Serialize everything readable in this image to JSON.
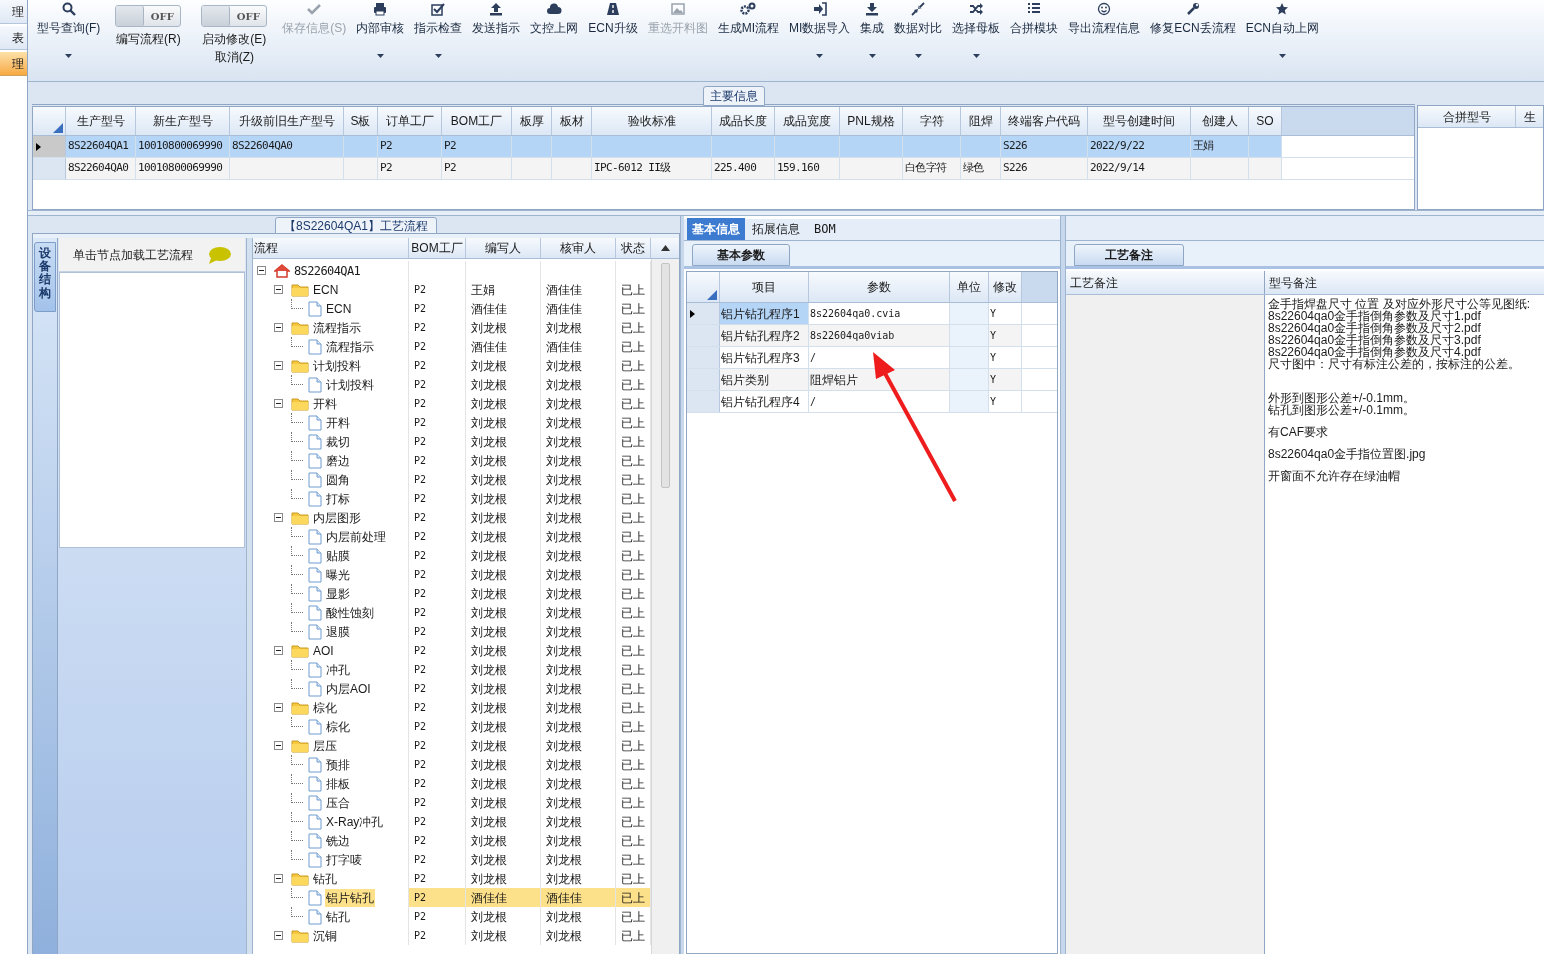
{
  "left_strip": [
    {
      "label": "理",
      "selected": false
    },
    {
      "label": "表",
      "selected": false
    },
    {
      "label": "理",
      "selected": true
    }
  ],
  "toolbar": [
    {
      "kind": "button",
      "label": "型号查询(F)",
      "disabled": false,
      "dropdown": true
    },
    {
      "kind": "toggle",
      "switch_text": "OFF",
      "on": false,
      "label": "编写流程(R)"
    },
    {
      "kind": "toggle",
      "switch_text": "OFF",
      "on": false,
      "label": "启动修改(E)",
      "label2": "取消(Z)"
    },
    {
      "kind": "button",
      "label": "保存信息(S)",
      "disabled": true,
      "dropdown": false
    },
    {
      "kind": "button",
      "label": "内部审核",
      "disabled": false,
      "dropdown": true
    },
    {
      "kind": "button",
      "label": "指示检查",
      "disabled": false,
      "dropdown": true
    },
    {
      "kind": "button",
      "label": "发送指示",
      "disabled": false,
      "dropdown": false
    },
    {
      "kind": "button",
      "label": "文控上网",
      "disabled": false,
      "dropdown": false
    },
    {
      "kind": "button",
      "label": "ECN升级",
      "disabled": false,
      "dropdown": false
    },
    {
      "kind": "button",
      "label": "重选开料图",
      "disabled": true,
      "dropdown": false
    },
    {
      "kind": "button",
      "label": "生成MI流程",
      "disabled": false,
      "dropdown": false
    },
    {
      "kind": "button",
      "label": "MI数据导入",
      "disabled": false,
      "dropdown": true
    },
    {
      "kind": "button",
      "label": "集成",
      "disabled": false,
      "dropdown": true
    },
    {
      "kind": "button",
      "label": "数据对比",
      "disabled": false,
      "dropdown": true
    },
    {
      "kind": "button",
      "label": "选择母板",
      "disabled": false,
      "dropdown": true
    },
    {
      "kind": "button",
      "label": "合拼模块",
      "disabled": false,
      "dropdown": false
    },
    {
      "kind": "button",
      "label": "导出流程信息",
      "disabled": false,
      "dropdown": false
    },
    {
      "kind": "button",
      "label": "修复ECN丢流程",
      "disabled": false,
      "dropdown": false
    },
    {
      "kind": "button",
      "label": "ECN自动上网",
      "disabled": false,
      "dropdown": true
    }
  ],
  "main_info": {
    "title": "主要信息",
    "columns": [
      "生产型号",
      "新生产型号",
      "升级前旧生产型号",
      "S板",
      "订单工厂",
      "BOM工厂",
      "板厚",
      "板材",
      "验收标准",
      "成品长度",
      "成品宽度",
      "PNL规格",
      "字符",
      "阻焊",
      "终端客户代码",
      "型号创建时间",
      "创建人",
      "SO"
    ],
    "rows": [
      {
        "selected": true,
        "cells": [
          "8S22604QA1",
          "10010800069990",
          "8S22604QA0",
          null,
          "P2",
          "P2",
          null,
          null,
          null,
          null,
          null,
          null,
          null,
          null,
          "S226",
          "2022/9/22",
          "王娟",
          null
        ]
      },
      {
        "selected": false,
        "cells": [
          "8S22604QA0",
          "10010800069990",
          null,
          null,
          "P2",
          "P2",
          null,
          null,
          "IPC-6012 II级",
          "225.400",
          "159.160",
          null,
          "白色字符",
          "绿色",
          "S226",
          "2022/9/14",
          null,
          null
        ]
      }
    ]
  },
  "merge_panel": {
    "columns": [
      "合拼型号",
      "生"
    ]
  },
  "process": {
    "title": "【8S22604QA1】工艺流程",
    "side_tab": "设备结构",
    "hint": "单击节点加载工艺流程",
    "columns": [
      "流程",
      "BOM工厂",
      "编写人",
      "核审人",
      "状态"
    ],
    "tree": [
      {
        "kind": "root",
        "label": "8S22604QA1",
        "selected": false,
        "expanded": true,
        "children": [
          {
            "kind": "folder",
            "label": "ECN",
            "bom": "P2",
            "writer": "王娟",
            "reviewer": "酒佳佳",
            "status": "已上",
            "selected": false,
            "expanded": true,
            "children": [
              {
                "kind": "leaf",
                "label": "ECN",
                "bom": "P2",
                "writer": "酒佳佳",
                "reviewer": "酒佳佳",
                "status": "已上",
                "selected": false
              }
            ]
          },
          {
            "kind": "folder",
            "label": "流程指示",
            "bom": "P2",
            "writer": "刘龙根",
            "reviewer": "刘龙根",
            "status": "已上",
            "selected": false,
            "expanded": true,
            "children": [
              {
                "kind": "leaf",
                "label": "流程指示",
                "bom": "P2",
                "writer": "酒佳佳",
                "reviewer": "酒佳佳",
                "status": "已上",
                "selected": false
              }
            ]
          },
          {
            "kind": "folder",
            "label": "计划投料",
            "bom": "P2",
            "writer": "刘龙根",
            "reviewer": "刘龙根",
            "status": "已上",
            "selected": false,
            "expanded": true,
            "children": [
              {
                "kind": "leaf",
                "label": "计划投料",
                "bom": "P2",
                "writer": "刘龙根",
                "reviewer": "刘龙根",
                "status": "已上",
                "selected": false
              }
            ]
          },
          {
            "kind": "folder",
            "label": "开料",
            "bom": "P2",
            "writer": "刘龙根",
            "reviewer": "刘龙根",
            "status": "已上",
            "selected": false,
            "expanded": true,
            "children": [
              {
                "kind": "leaf",
                "label": "开料",
                "bom": "P2",
                "writer": "刘龙根",
                "reviewer": "刘龙根",
                "status": "已上",
                "selected": false
              },
              {
                "kind": "leaf",
                "label": "裁切",
                "bom": "P2",
                "writer": "刘龙根",
                "reviewer": "刘龙根",
                "status": "已上",
                "selected": false
              },
              {
                "kind": "leaf",
                "label": "磨边",
                "bom": "P2",
                "writer": "刘龙根",
                "reviewer": "刘龙根",
                "status": "已上",
                "selected": false
              },
              {
                "kind": "leaf",
                "label": "圆角",
                "bom": "P2",
                "writer": "刘龙根",
                "reviewer": "刘龙根",
                "status": "已上",
                "selected": false
              },
              {
                "kind": "leaf",
                "label": "打标",
                "bom": "P2",
                "writer": "刘龙根",
                "reviewer": "刘龙根",
                "status": "已上",
                "selected": false
              }
            ]
          },
          {
            "kind": "folder",
            "label": "内层图形",
            "bom": "P2",
            "writer": "刘龙根",
            "reviewer": "刘龙根",
            "status": "已上",
            "selected": false,
            "expanded": true,
            "children": [
              {
                "kind": "leaf",
                "label": "内层前处理",
                "bom": "P2",
                "writer": "刘龙根",
                "reviewer": "刘龙根",
                "status": "已上",
                "selected": false
              },
              {
                "kind": "leaf",
                "label": "贴膜",
                "bom": "P2",
                "writer": "刘龙根",
                "reviewer": "刘龙根",
                "status": "已上",
                "selected": false
              },
              {
                "kind": "leaf",
                "label": "曝光",
                "bom": "P2",
                "writer": "刘龙根",
                "reviewer": "刘龙根",
                "status": "已上",
                "selected": false
              },
              {
                "kind": "leaf",
                "label": "显影",
                "bom": "P2",
                "writer": "刘龙根",
                "reviewer": "刘龙根",
                "status": "已上",
                "selected": false
              },
              {
                "kind": "leaf",
                "label": "酸性蚀刻",
                "bom": "P2",
                "writer": "刘龙根",
                "reviewer": "刘龙根",
                "status": "已上",
                "selected": false
              },
              {
                "kind": "leaf",
                "label": "退膜",
                "bom": "P2",
                "writer": "刘龙根",
                "reviewer": "刘龙根",
                "status": "已上",
                "selected": false
              }
            ]
          },
          {
            "kind": "folder",
            "label": "AOI",
            "bom": "P2",
            "writer": "刘龙根",
            "reviewer": "刘龙根",
            "status": "已上",
            "selected": false,
            "expanded": true,
            "children": [
              {
                "kind": "leaf",
                "label": "冲孔",
                "bom": "P2",
                "writer": "刘龙根",
                "reviewer": "刘龙根",
                "status": "已上",
                "selected": false
              },
              {
                "kind": "leaf",
                "label": "内层AOI",
                "bom": "P2",
                "writer": "刘龙根",
                "reviewer": "刘龙根",
                "status": "已上",
                "selected": false
              }
            ]
          },
          {
            "kind": "folder",
            "label": "棕化",
            "bom": "P2",
            "writer": "刘龙根",
            "reviewer": "刘龙根",
            "status": "已上",
            "selected": false,
            "expanded": true,
            "children": [
              {
                "kind": "leaf",
                "label": "棕化",
                "bom": "P2",
                "writer": "刘龙根",
                "reviewer": "刘龙根",
                "status": "已上",
                "selected": false
              }
            ]
          },
          {
            "kind": "folder",
            "label": "层压",
            "bom": "P2",
            "writer": "刘龙根",
            "reviewer": "刘龙根",
            "status": "已上",
            "selected": false,
            "expanded": true,
            "children": [
              {
                "kind": "leaf",
                "label": "预排",
                "bom": "P2",
                "writer": "刘龙根",
                "reviewer": "刘龙根",
                "status": "已上",
                "selected": false
              },
              {
                "kind": "leaf",
                "label": "排板",
                "bom": "P2",
                "writer": "刘龙根",
                "reviewer": "刘龙根",
                "status": "已上",
                "selected": false
              },
              {
                "kind": "leaf",
                "label": "压合",
                "bom": "P2",
                "writer": "刘龙根",
                "reviewer": "刘龙根",
                "status": "已上",
                "selected": false
              },
              {
                "kind": "leaf",
                "label": "X-Ray冲孔",
                "bom": "P2",
                "writer": "刘龙根",
                "reviewer": "刘龙根",
                "status": "已上",
                "selected": false
              },
              {
                "kind": "leaf",
                "label": "铣边",
                "bom": "P2",
                "writer": "刘龙根",
                "reviewer": "刘龙根",
                "status": "已上",
                "selected": false
              },
              {
                "kind": "leaf",
                "label": "打字唛",
                "bom": "P2",
                "writer": "刘龙根",
                "reviewer": "刘龙根",
                "status": "已上",
                "selected": false
              }
            ]
          },
          {
            "kind": "folder",
            "label": "钻孔",
            "bom": "P2",
            "writer": "刘龙根",
            "reviewer": "刘龙根",
            "status": "已上",
            "selected": false,
            "expanded": true,
            "children": [
              {
                "kind": "leaf",
                "label": "铝片钻孔",
                "bom": "P2",
                "writer": "酒佳佳",
                "reviewer": "酒佳佳",
                "status": "已上",
                "selected": true
              },
              {
                "kind": "leaf",
                "label": "钻孔",
                "bom": "P2",
                "writer": "刘龙根",
                "reviewer": "刘龙根",
                "status": "已上",
                "selected": false
              }
            ]
          },
          {
            "kind": "folder",
            "label": "沉铜",
            "bom": "P2",
            "writer": "刘龙根",
            "reviewer": "刘龙根",
            "status": "已上",
            "selected": false,
            "expanded": true
          }
        ]
      }
    ]
  },
  "detail": {
    "tabs": [
      {
        "label": "基本信息",
        "selected": true
      },
      {
        "label": "拓展信息",
        "selected": false
      },
      {
        "label": "BOM",
        "selected": false
      }
    ],
    "sub_tab": "基本参数",
    "columns": [
      "项目",
      "参数",
      "单位",
      "修改"
    ],
    "rows": [
      {
        "selected": true,
        "item": "铝片钻孔程序1",
        "param": "8s22604qa0.cvia",
        "modify": "Y"
      },
      {
        "selected": false,
        "item": "铝片钻孔程序2",
        "param": "8s22604qa0viab",
        "modify": "Y"
      },
      {
        "selected": false,
        "item": "铝片钻孔程序3",
        "param": "/",
        "modify": "Y"
      },
      {
        "selected": false,
        "item": "铝片类别",
        "param": "阻焊铝片",
        "modify": "Y"
      },
      {
        "selected": false,
        "item": "铝片钻孔程序4",
        "param": "/",
        "modify": "Y"
      }
    ]
  },
  "remarks": {
    "tab": "工艺备注",
    "columns": [
      "工艺备注",
      "型号备注"
    ],
    "paragraphs": [
      [
        "金手指焊盘尺寸 位置 及对应外形尺寸公等见图纸:",
        "8s22604qa0金手指倒角参数及尺寸1.pdf",
        "8s22604qa0金手指倒角参数及尺寸2.pdf",
        "8s22604qa0金手指倒角参数及尺寸3.pdf",
        "8s22604qa0金手指倒角参数及尺寸4.pdf",
        "尺寸图中：尺寸有标注公差的，按标注的公差。"
      ],
      [
        "外形到图形公差+/-0.1mm。",
        "钻孔到图形公差+/-0.1mm。"
      ],
      [
        "有CAF要求"
      ],
      [
        "8s22604qa0金手指位置图.jpg"
      ],
      [
        "开窗面不允许存在绿油帽"
      ]
    ]
  }
}
